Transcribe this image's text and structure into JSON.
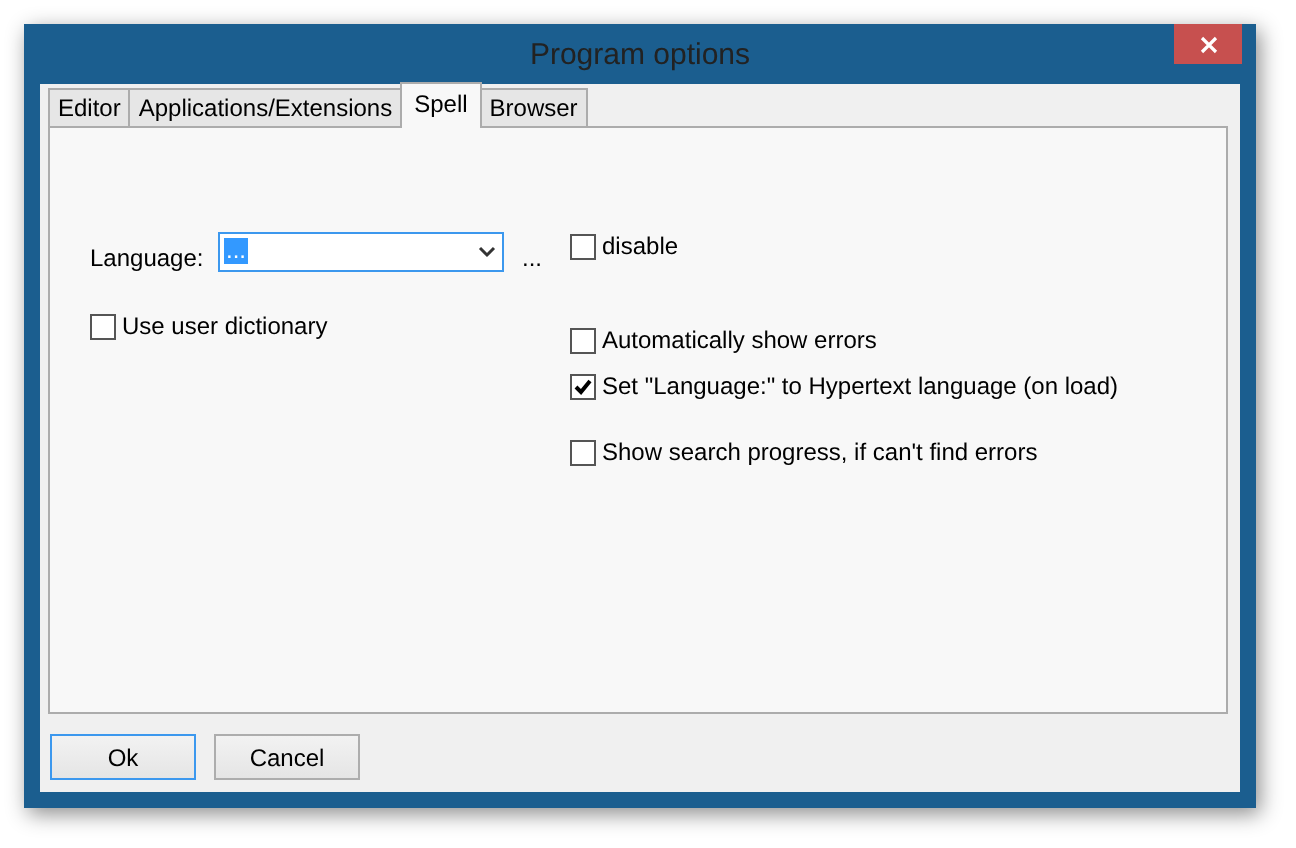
{
  "window": {
    "title": "Program options"
  },
  "tabs": [
    {
      "label": "Editor",
      "selected": false
    },
    {
      "label": "Applications/Extensions",
      "selected": false
    },
    {
      "label": "Spell",
      "selected": true
    },
    {
      "label": "Browser",
      "selected": false
    }
  ],
  "language": {
    "label": "Language:",
    "value": "...",
    "more": "..."
  },
  "left_options": [
    {
      "label": "Use user dictionary",
      "checked": false
    }
  ],
  "right_options": [
    {
      "label": "disable",
      "checked": false
    },
    {
      "label": "Automatically show errors",
      "checked": false
    },
    {
      "label": "Set \"Language:\" to Hypertext language (on load)",
      "checked": true
    },
    {
      "label": "Show search progress, if can't find errors",
      "checked": false
    }
  ],
  "buttons": [
    {
      "label": "Ok",
      "default": true
    },
    {
      "label": "Cancel",
      "default": false
    }
  ]
}
